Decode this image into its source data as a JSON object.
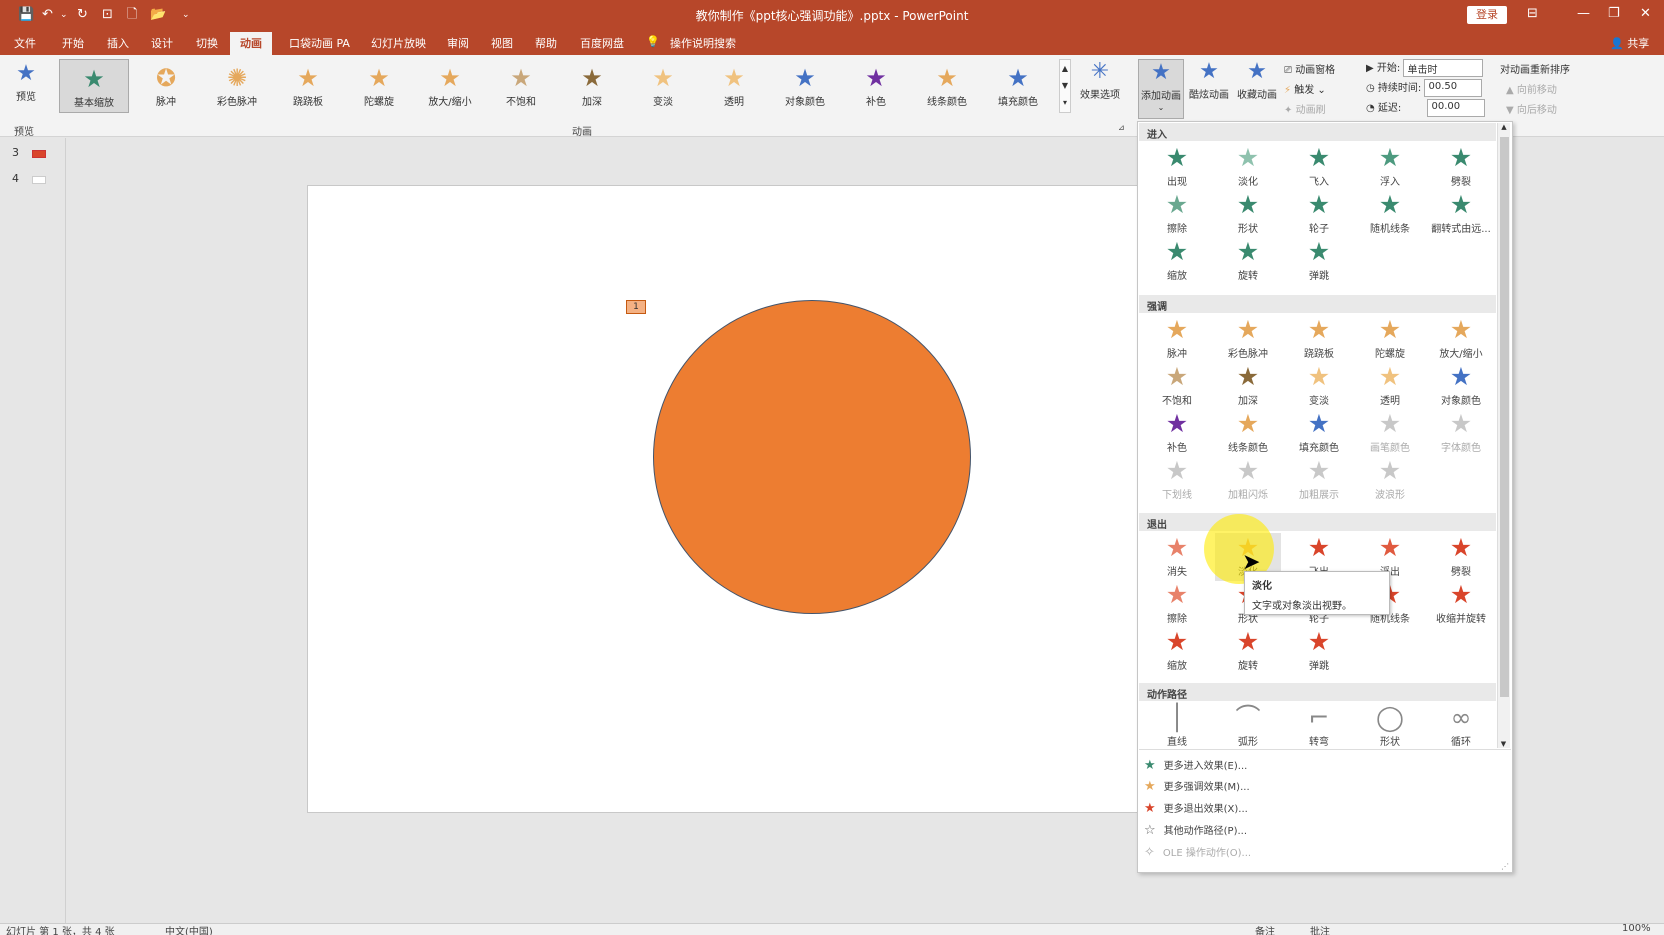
{
  "title_bar": {
    "document_title": "教你制作《ppt核心强调功能》.pptx - PowerPoint",
    "login": "登录",
    "quick_access": [
      "💾",
      "↶",
      "⌄",
      "↻",
      "⊡",
      "🗋",
      "📂",
      "⌄"
    ]
  },
  "tabs": [
    "文件",
    "开始",
    "插入",
    "设计",
    "切换",
    "动画",
    "口袋动画 PA",
    "幻灯片放映",
    "审阅",
    "视图",
    "帮助",
    "百度网盘",
    "操作说明搜索"
  ],
  "active_tab": "动画",
  "share": "共享",
  "ribbon": {
    "preview": "预览",
    "gallery": [
      "基本缩放",
      "脉冲",
      "彩色脉冲",
      "跷跷板",
      "陀螺旋",
      "放大/缩小",
      "不饱和",
      "加深",
      "变淡",
      "透明",
      "对象颜色",
      "补色",
      "线条颜色",
      "填充颜色"
    ],
    "gallery_selected": "基本缩放",
    "effect_options": "效果选项",
    "add_animation": "添加动画",
    "cool_animation": "酷炫动画",
    "fav_animation": "收藏动画",
    "animation_pane": "动画窗格",
    "trigger": "触发",
    "animation_painter": "动画刷",
    "start_label": "开始:",
    "start_value": "单击时",
    "duration_label": "持续时间:",
    "duration_value": "00.50",
    "delay_label": "延迟:",
    "delay_value": "00.00",
    "reorder": "对动画重新排序",
    "move_earlier": "向前移动",
    "move_later": "向后移动",
    "group_preview": "预览",
    "group_animation": "动画"
  },
  "slides": [
    "3",
    "4"
  ],
  "seq_tag": "1",
  "panel": {
    "sections": [
      {
        "title": "进入",
        "items": [
          {
            "label": "出现",
            "color": "#3a8a6f"
          },
          {
            "label": "淡化",
            "color": "#8fc2ae"
          },
          {
            "label": "飞入",
            "color": "#3a8a6f"
          },
          {
            "label": "浮入",
            "color": "#4d9a7f"
          },
          {
            "label": "劈裂",
            "color": "#3a8a6f"
          },
          {
            "label": "擦除",
            "color": "#6aa890"
          },
          {
            "label": "形状",
            "color": "#3a8a6f"
          },
          {
            "label": "轮子",
            "color": "#3a8a6f"
          },
          {
            "label": "随机线条",
            "color": "#3a8a6f"
          },
          {
            "label": "翻转式由远...",
            "color": "#3a8a6f"
          },
          {
            "label": "缩放",
            "color": "#3a8a6f"
          },
          {
            "label": "旋转",
            "color": "#3a8a6f"
          },
          {
            "label": "弹跳",
            "color": "#3a8a6f"
          }
        ]
      },
      {
        "title": "强调",
        "items": [
          {
            "label": "脉冲",
            "color": "#e5a85c"
          },
          {
            "label": "彩色脉冲",
            "color": "#e5a85c"
          },
          {
            "label": "跷跷板",
            "color": "#e5a85c"
          },
          {
            "label": "陀螺旋",
            "color": "#e5a85c"
          },
          {
            "label": "放大/缩小",
            "color": "#e5a85c"
          },
          {
            "label": "不饱和",
            "color": "#c9a77a"
          },
          {
            "label": "加深",
            "color": "#8a6a3a"
          },
          {
            "label": "变淡",
            "color": "#f0c27f"
          },
          {
            "label": "透明",
            "color": "#f0c27f"
          },
          {
            "label": "对象颜色",
            "color": "#4472c4"
          },
          {
            "label": "补色",
            "color": "#7030a0"
          },
          {
            "label": "线条颜色",
            "color": "#e5a85c"
          },
          {
            "label": "填充颜色",
            "color": "#4472c4"
          },
          {
            "label": "画笔颜色",
            "color": "#c8c8c8",
            "disabled": true
          },
          {
            "label": "字体颜色",
            "color": "#c8c8c8",
            "disabled": true
          },
          {
            "label": "下划线",
            "color": "#c8c8c8",
            "disabled": true
          },
          {
            "label": "加粗闪烁",
            "color": "#c8c8c8",
            "disabled": true
          },
          {
            "label": "加粗展示",
            "color": "#c8c8c8",
            "disabled": true
          },
          {
            "label": "波浪形",
            "color": "#c8c8c8",
            "disabled": true
          }
        ]
      },
      {
        "title": "退出",
        "items": [
          {
            "label": "消失",
            "color": "#e8826a"
          },
          {
            "label": "淡化",
            "color": "#e5a85c"
          },
          {
            "label": "飞出",
            "color": "#d9452b"
          },
          {
            "label": "浮出",
            "color": "#e05a3f"
          },
          {
            "label": "劈裂",
            "color": "#d9452b"
          },
          {
            "label": "擦除",
            "color": "#e8826a"
          },
          {
            "label": "形状",
            "color": "#d9452b"
          },
          {
            "label": "轮子",
            "color": "#d9452b"
          },
          {
            "label": "随机线条",
            "color": "#d9452b"
          },
          {
            "label": "收缩并旋转",
            "color": "#d9452b"
          },
          {
            "label": "缩放",
            "color": "#d9452b"
          },
          {
            "label": "旋转",
            "color": "#d9452b"
          },
          {
            "label": "弹跳",
            "color": "#d9452b"
          }
        ]
      },
      {
        "title": "动作路径",
        "items": [
          {
            "label": "直线",
            "color": "#888"
          },
          {
            "label": "弧形",
            "color": "#888"
          },
          {
            "label": "转弯",
            "color": "#888"
          },
          {
            "label": "形状",
            "color": "#888"
          },
          {
            "label": "循环",
            "color": "#888"
          }
        ]
      }
    ],
    "more": [
      {
        "label": "更多进入效果(E)...",
        "color": "#3a8a6f"
      },
      {
        "label": "更多强调效果(M)...",
        "color": "#e5a85c"
      },
      {
        "label": "更多退出效果(X)...",
        "color": "#d9452b"
      },
      {
        "label": "其他动作路径(P)...",
        "color": "#666"
      },
      {
        "label": "OLE 操作动作(O)...",
        "color": "#aaa",
        "disabled": true
      }
    ]
  },
  "tooltip": {
    "title": "淡化",
    "desc": "文字或对象淡出视野。"
  },
  "status": {
    "slide": "幻灯片 第 1 张，共 4 张",
    "lang": "中文(中国)",
    "notes": "备注",
    "comments": "批注",
    "zoom": "100%"
  }
}
